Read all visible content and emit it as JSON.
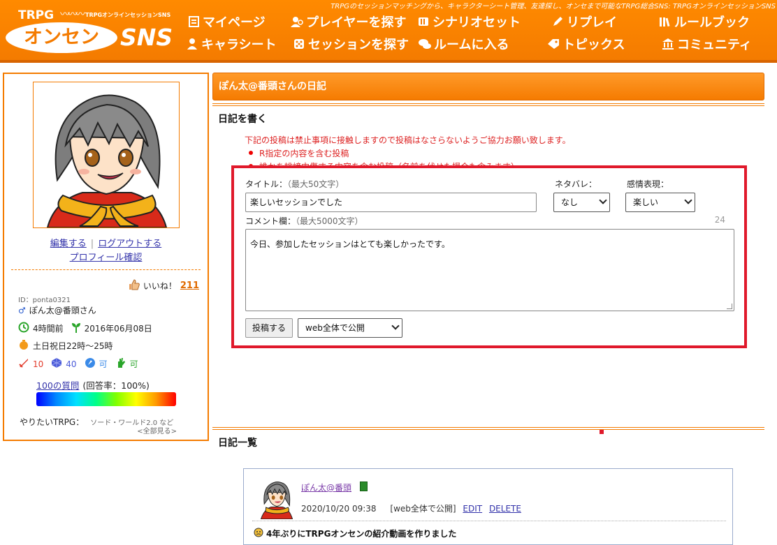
{
  "header": {
    "tagline": "TRPGのセッションマッチングから、キャラクターシート管理、友達探し、オンセまで可能なTRPG総合SNS: TRPGオンラインセッションSNS",
    "logo": {
      "trpg": "TRPG",
      "subtitle": "TRPGオンラインセッションSNS",
      "main": "オンセン",
      "sns": "SNS"
    },
    "nav": [
      {
        "label": "マイページ",
        "icon": "document-icon"
      },
      {
        "label": "プレイヤーを探す",
        "icon": "user-search-icon"
      },
      {
        "label": "シナリオセット",
        "icon": "books-icon"
      },
      {
        "label": "リプレイ",
        "icon": "pen-icon"
      },
      {
        "label": "ルールブック",
        "icon": "library-icon"
      },
      {
        "label": "キャラシート",
        "icon": "person-icon"
      },
      {
        "label": "セッションを探す",
        "icon": "dice-icon"
      },
      {
        "label": "ルームに入る",
        "icon": "chat-icon"
      },
      {
        "label": "トピックス",
        "icon": "tag-icon"
      },
      {
        "label": "コミュニティ",
        "icon": "building-icon"
      }
    ]
  },
  "profile": {
    "edit_link": "編集する",
    "logout_link": "ログアウトする",
    "profile_link": "プロフィール確認",
    "like_label": "いいね！",
    "like_count": "211",
    "id_label": "ID：ponta0321",
    "name": "ぽん太@番頭さん",
    "last_login": "4時間前",
    "joined": "2016年06月08日",
    "schedule": "土日祝日22時～25時",
    "stat_sword": "10",
    "stat_dice": "40",
    "stat_gm": "可",
    "stat_hand": "可",
    "questions_link": "100の質問",
    "answer_rate": "(回答率：100%)",
    "want_label": "やりたいTRPG：",
    "want_value": "ソード・ワールド2.0 など",
    "see_all": "<全部見る>"
  },
  "main": {
    "page_title": "ぽん太@番頭さんの日記",
    "write_heading": "日記を書く",
    "notice_lines": [
      "下記の投稿は禁止事項に接触しますので投稿はなさらないようご協力お願い致します。",
      "R指定の内容を含む投稿",
      "誰かを誹謗中傷する内容を含む投稿（名前を伏せた場合も含みます）"
    ],
    "form": {
      "title_label": "タイトル：",
      "title_hint": "（最大50文字）",
      "title_value": "楽しいセッションでした",
      "spoiler_label": "ネタバレ：",
      "spoiler_value": "なし",
      "emotion_label": "感情表現：",
      "emotion_value": "楽しい",
      "comment_label": "コメント欄：",
      "comment_hint": "（最大5000文字）",
      "char_count": "24",
      "comment_value": "今日、参加したセッションはとても楽しかったです。",
      "submit_label": "投稿する",
      "visibility_value": "web全体で公開"
    },
    "list_heading": "日記一覧",
    "entry": {
      "author": "ぽん太@番頭",
      "datetime": "2020/10/20 09:38",
      "visibility": "[web全体で公開]",
      "edit": "EDIT",
      "delete": "DELETE",
      "title": "4年ぶりにTRPGオンセンの紹介動画を作りました"
    }
  },
  "colors": {
    "brand_orange": "#f47b00",
    "highlight_red": "#e0192b",
    "notice_red": "#dd2222"
  }
}
